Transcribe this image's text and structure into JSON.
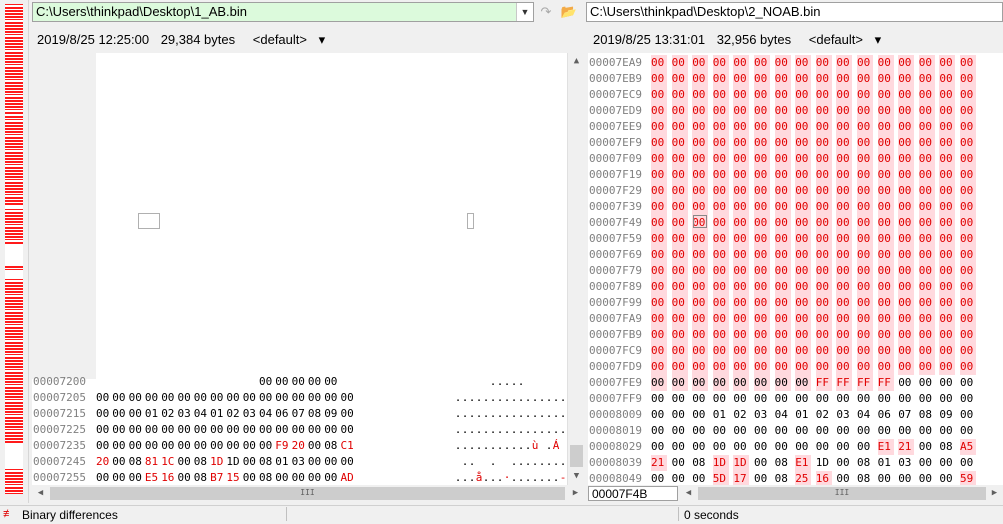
{
  "left": {
    "path": "C:\\Users\\thinkpad\\Desktop\\1_AB.bin",
    "date": "2019/8/25 12:25:00",
    "size": "29,384 bytes",
    "encoding": "<default>",
    "rows": [
      {
        "addr": "00007200",
        "bytes": [
          "",
          "",
          "",
          "",
          "",
          "",
          "",
          "",
          "",
          "",
          "00",
          "00",
          "00",
          "00",
          "00",
          ""
        ],
        "ascii": "     .....",
        "diff": []
      },
      {
        "addr": "00007205",
        "bytes": [
          "00",
          "00",
          "00",
          "00",
          "00",
          "00",
          "00",
          "00",
          "00",
          "00",
          "00",
          "00",
          "00",
          "00",
          "00",
          "00"
        ],
        "ascii": "................",
        "diff": []
      },
      {
        "addr": "00007215",
        "bytes": [
          "00",
          "00",
          "00",
          "01",
          "02",
          "03",
          "04",
          "01",
          "02",
          "03",
          "04",
          "06",
          "07",
          "08",
          "09",
          "00"
        ],
        "ascii": "................",
        "diff": []
      },
      {
        "addr": "00007225",
        "bytes": [
          "00",
          "00",
          "00",
          "00",
          "00",
          "00",
          "00",
          "00",
          "00",
          "00",
          "00",
          "00",
          "00",
          "00",
          "00",
          "00"
        ],
        "ascii": "................",
        "diff": []
      },
      {
        "addr": "00007235",
        "bytes": [
          "00",
          "00",
          "00",
          "00",
          "00",
          "00",
          "00",
          "00",
          "00",
          "00",
          "00",
          "F9",
          "20",
          "00",
          "08",
          "C1"
        ],
        "ascii": "...........ù .Á",
        "diff": [
          11,
          12,
          15
        ]
      },
      {
        "addr": "00007245",
        "bytes": [
          "20",
          "00",
          "08",
          "81",
          "1C",
          "00",
          "08",
          "1D",
          "1D",
          "00",
          "08",
          "01",
          "03",
          "00",
          "00",
          "00"
        ],
        "ascii": " ..  .  .........",
        "diff": [
          0,
          3,
          4,
          7
        ]
      },
      {
        "addr": "00007255",
        "bytes": [
          "00",
          "00",
          "00",
          "E5",
          "16",
          "00",
          "08",
          "B7",
          "15",
          "00",
          "08",
          "00",
          "00",
          "00",
          "00",
          "AD"
        ],
        "ascii": "...å...·.......-",
        "diff": [
          3,
          4,
          7,
          8,
          15
        ]
      }
    ]
  },
  "right": {
    "path": "C:\\Users\\thinkpad\\Desktop\\2_NOAB.bin",
    "date": "2019/8/25 13:31:01",
    "size": "32,956 bytes",
    "encoding": "<default>",
    "position": "00007F4B",
    "zero_rows": [
      "00007EA9",
      "00007EB9",
      "00007EC9",
      "00007ED9",
      "00007EE9",
      "00007EF9",
      "00007F09",
      "00007F19",
      "00007F29",
      "00007F39",
      "00007F49",
      "00007F59",
      "00007F69",
      "00007F79",
      "00007F89",
      "00007F99",
      "00007FA9",
      "00007FB9",
      "00007FC9",
      "00007FD9"
    ],
    "rows": [
      {
        "addr": "00007FE9",
        "bytes": [
          "00",
          "00",
          "00",
          "00",
          "00",
          "00",
          "00",
          "00",
          "FF",
          "FF",
          "FF",
          "FF",
          "00",
          "00",
          "00",
          "00"
        ],
        "hl": [
          0,
          1,
          2,
          3,
          4,
          5,
          6,
          7,
          8,
          9,
          10,
          11
        ],
        "diff": [
          8,
          9,
          10,
          11
        ]
      },
      {
        "addr": "00007FF9",
        "bytes": [
          "00",
          "00",
          "00",
          "00",
          "00",
          "00",
          "00",
          "00",
          "00",
          "00",
          "00",
          "00",
          "00",
          "00",
          "00",
          "00"
        ],
        "hl": [],
        "diff": []
      },
      {
        "addr": "00008009",
        "bytes": [
          "00",
          "00",
          "00",
          "01",
          "02",
          "03",
          "04",
          "01",
          "02",
          "03",
          "04",
          "06",
          "07",
          "08",
          "09",
          "00"
        ],
        "hl": [],
        "diff": []
      },
      {
        "addr": "00008019",
        "bytes": [
          "00",
          "00",
          "00",
          "00",
          "00",
          "00",
          "00",
          "00",
          "00",
          "00",
          "00",
          "00",
          "00",
          "00",
          "00",
          "00"
        ],
        "hl": [],
        "diff": []
      },
      {
        "addr": "00008029",
        "bytes": [
          "00",
          "00",
          "00",
          "00",
          "00",
          "00",
          "00",
          "00",
          "00",
          "00",
          "00",
          "E1",
          "21",
          "00",
          "08",
          "A5"
        ],
        "hl": [
          11,
          12,
          15
        ],
        "diff": [
          11,
          12,
          15
        ]
      },
      {
        "addr": "00008039",
        "bytes": [
          "21",
          "00",
          "08",
          "1D",
          "1D",
          "00",
          "08",
          "E1",
          "1D",
          "00",
          "08",
          "01",
          "03",
          "00",
          "00",
          "00"
        ],
        "hl": [
          0,
          3,
          4,
          7
        ],
        "diff": [
          0,
          3,
          4,
          7
        ]
      },
      {
        "addr": "00008049",
        "bytes": [
          "00",
          "00",
          "00",
          "5D",
          "17",
          "00",
          "08",
          "25",
          "16",
          "00",
          "08",
          "00",
          "00",
          "00",
          "00",
          "59"
        ],
        "hl": [
          3,
          4,
          7,
          8,
          15
        ],
        "diff": [
          3,
          4,
          7,
          8,
          15
        ]
      }
    ]
  },
  "status": {
    "label": "Binary differences",
    "time": "0 seconds"
  },
  "icons": {
    "swap": "swap-arrow-icon",
    "folder": "open-folder-icon",
    "status": "diff-status-icon"
  },
  "colors": {
    "diff_text": "#e00000",
    "diff_bg": "#ffd9de",
    "left_path_bg": "#dcfadc",
    "overview_marker": "#ff1a1a"
  }
}
